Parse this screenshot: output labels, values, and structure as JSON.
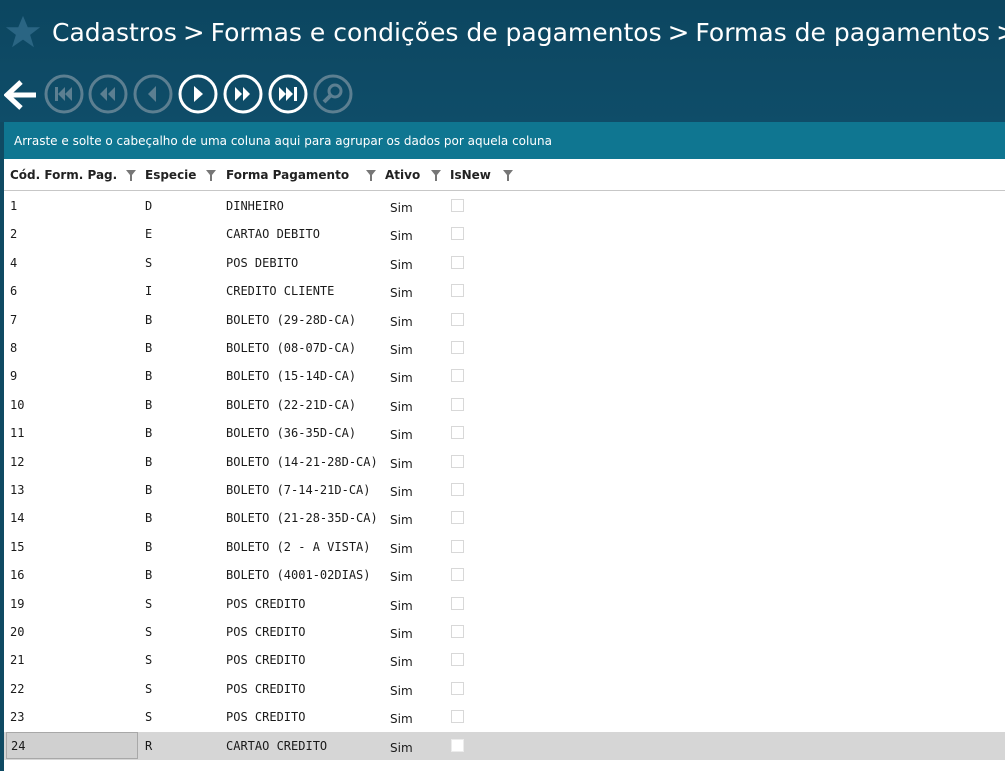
{
  "breadcrumb": {
    "items": [
      "Cadastros",
      "Formas e condições de pagamentos",
      "Formas de pagamentos"
    ],
    "separator": ">"
  },
  "toolbar": {
    "icons": [
      "back-arrow-icon",
      "first-icon",
      "previous-page-icon",
      "previous-icon",
      "next-icon",
      "next-page-icon",
      "last-icon",
      "search-icon"
    ]
  },
  "grid": {
    "group_hint": "Arraste e solte o cabeçalho de uma coluna aqui para agrupar os dados por aquela coluna",
    "columns": [
      "Cód. Form. Pag.",
      "Especie",
      "Forma Pagamento",
      "Ativo",
      "IsNew"
    ],
    "rows": [
      {
        "code": "1",
        "especie": "D",
        "forma": "DINHEIRO",
        "ativo": "Sim",
        "isnew": false
      },
      {
        "code": "2",
        "especie": "E",
        "forma": "CARTAO DEBITO",
        "ativo": "Sim",
        "isnew": false
      },
      {
        "code": "4",
        "especie": "S",
        "forma": "POS DEBITO",
        "ativo": "Sim",
        "isnew": false
      },
      {
        "code": "6",
        "especie": "I",
        "forma": "CREDITO CLIENTE",
        "ativo": "Sim",
        "isnew": false
      },
      {
        "code": "7",
        "especie": "B",
        "forma": "BOLETO (29-28D-CA)",
        "ativo": "Sim",
        "isnew": false
      },
      {
        "code": "8",
        "especie": "B",
        "forma": "BOLETO (08-07D-CA)",
        "ativo": "Sim",
        "isnew": false
      },
      {
        "code": "9",
        "especie": "B",
        "forma": "BOLETO (15-14D-CA)",
        "ativo": "Sim",
        "isnew": false
      },
      {
        "code": "10",
        "especie": "B",
        "forma": "BOLETO (22-21D-CA)",
        "ativo": "Sim",
        "isnew": false
      },
      {
        "code": "11",
        "especie": "B",
        "forma": "BOLETO (36-35D-CA)",
        "ativo": "Sim",
        "isnew": false
      },
      {
        "code": "12",
        "especie": "B",
        "forma": "BOLETO (14-21-28D-CA)",
        "ativo": "Sim",
        "isnew": false
      },
      {
        "code": "13",
        "especie": "B",
        "forma": "BOLETO (7-14-21D-CA)",
        "ativo": "Sim",
        "isnew": false
      },
      {
        "code": "14",
        "especie": "B",
        "forma": "BOLETO (21-28-35D-CA)",
        "ativo": "Sim",
        "isnew": false
      },
      {
        "code": "15",
        "especie": "B",
        "forma": "BOLETO (2 - A VISTA)",
        "ativo": "Sim",
        "isnew": false
      },
      {
        "code": "16",
        "especie": "B",
        "forma": "BOLETO (4001-02DIAS)",
        "ativo": "Sim",
        "isnew": false
      },
      {
        "code": "19",
        "especie": "S",
        "forma": "POS CREDITO",
        "ativo": "Sim",
        "isnew": false
      },
      {
        "code": "20",
        "especie": "S",
        "forma": "POS CREDITO",
        "ativo": "Sim",
        "isnew": false
      },
      {
        "code": "21",
        "especie": "S",
        "forma": "POS CREDITO",
        "ativo": "Sim",
        "isnew": false
      },
      {
        "code": "22",
        "especie": "S",
        "forma": "POS CREDITO",
        "ativo": "Sim",
        "isnew": false
      },
      {
        "code": "23",
        "especie": "S",
        "forma": "POS CREDITO",
        "ativo": "Sim",
        "isnew": false
      },
      {
        "code": "24",
        "especie": "R",
        "forma": "CARTAO CREDITO",
        "ativo": "Sim",
        "isnew": false,
        "selected": true
      }
    ]
  },
  "colors": {
    "header_bg": "#0f4a63",
    "groupbar_bg": "#0f7691",
    "selected_row": "#d6d6d6"
  }
}
